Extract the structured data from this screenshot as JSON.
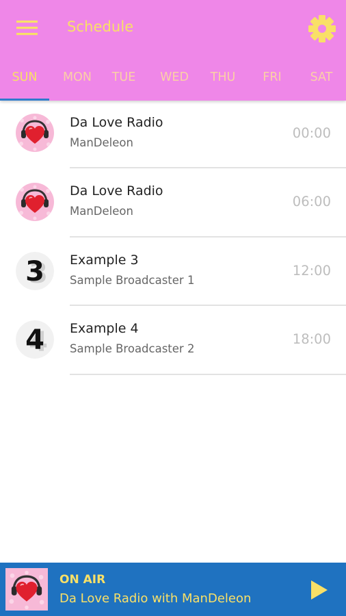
{
  "toolbar": {
    "menu_icon": "hamburger-menu-icon",
    "title": "Schedule",
    "settings_icon": "gear-icon"
  },
  "tabs": [
    {
      "label": "SUN",
      "active": true
    },
    {
      "label": "MON",
      "active": false
    },
    {
      "label": "TUE",
      "active": false
    },
    {
      "label": "WED",
      "active": false
    },
    {
      "label": "THU",
      "active": false
    },
    {
      "label": "FRI",
      "active": false
    },
    {
      "label": "SAT",
      "active": false
    }
  ],
  "schedule": [
    {
      "title": "Da Love Radio",
      "host": "ManDeleon",
      "time": "00:00",
      "art": "heart-headphones-logo"
    },
    {
      "title": "Da Love Radio",
      "host": "ManDeleon",
      "time": "06:00",
      "art": "heart-headphones-logo"
    },
    {
      "title": "Example 3",
      "host": "Sample Broadcaster 1",
      "time": "12:00",
      "art": "number-3-logo"
    },
    {
      "title": "Example 4",
      "host": "Sample Broadcaster 2",
      "time": "18:00",
      "art": "number-4-logo"
    }
  ],
  "player": {
    "status": "ON AIR",
    "now_playing": "Da Love Radio with ManDeleon",
    "play_icon": "play-icon"
  },
  "colors": {
    "header_bg": "#ef87e8",
    "accent_yellow": "#f9e067",
    "tab_inactive": "#fbd0a6",
    "tab_indicator": "#2f7ccc",
    "player_bg": "#1f72c0"
  }
}
